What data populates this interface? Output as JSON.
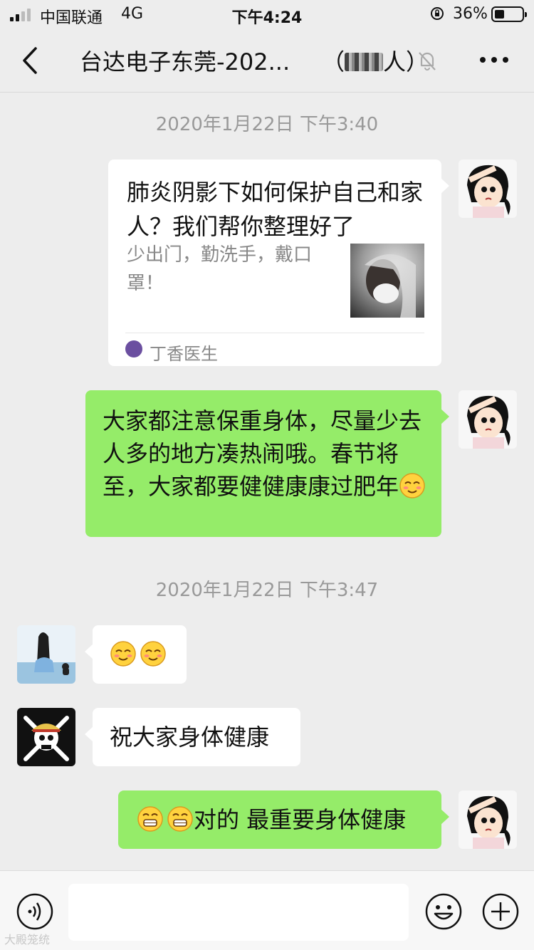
{
  "status_bar": {
    "carrier": "中国联通",
    "network": "4G",
    "time": "下午4:24",
    "battery_text": "36%",
    "battery_level": 0.36
  },
  "nav": {
    "title": "台达电子东莞-202...",
    "member_prefix": "（",
    "member_suffix": "人）"
  },
  "messages": {
    "timestamp_1": "2020年1月22日 下午3:40",
    "card": {
      "title": "肺炎阴影下如何保护自己和家人？我们帮你整理好了",
      "description": "少出门，勤洗手，戴口罩！",
      "source": "丁香医生"
    },
    "green_1": "大家都注意保重身体，尽量少去人多的地方凑热闹哦。春节将至，大家都要健健康康过肥年",
    "timestamp_2": "2020年1月22日 下午3:47",
    "white_2": "祝大家身体健康",
    "green_2": "对的 最重要身体健康"
  },
  "watermark": "大殿笼统",
  "icons": {
    "back": "back-chevron-icon",
    "mute": "bell-mute-icon",
    "more": "more-dots-icon",
    "voice": "voice-icon",
    "sticker": "smile-icon",
    "plus": "plus-icon"
  }
}
